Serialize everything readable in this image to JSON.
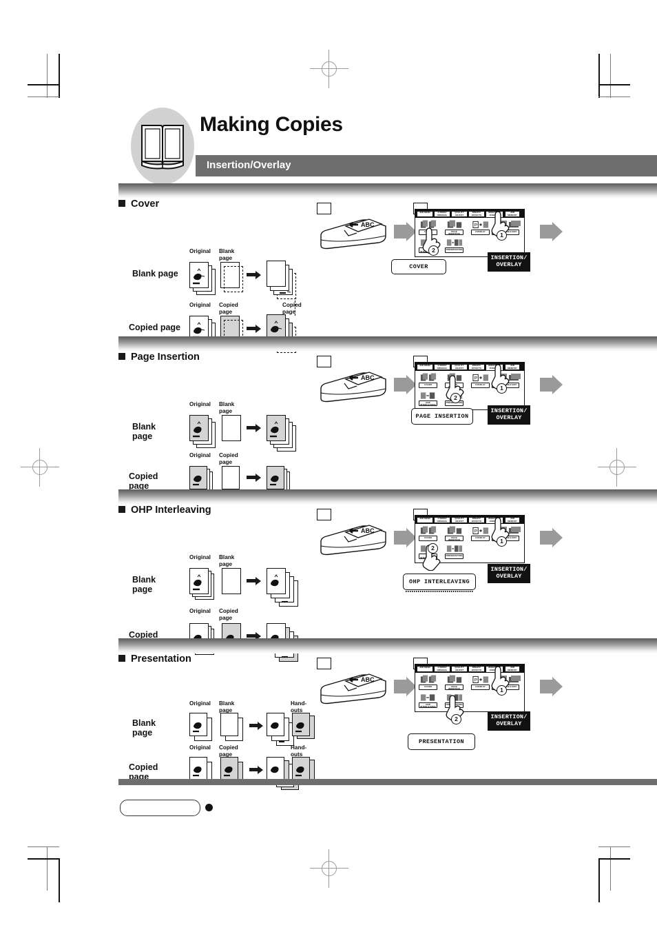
{
  "header": {
    "title": "Making Copies",
    "subtitle": "Insertion/Overlay",
    "icon": "open-book-icon"
  },
  "sections": [
    {
      "id": "cover",
      "title": "Cover",
      "rows": [
        {
          "label": "Blank page",
          "columns": [
            "Original",
            "Blank page",
            "",
            ""
          ]
        },
        {
          "label": "Copied page",
          "columns": [
            "Original",
            "Copied page",
            "Copied page",
            ""
          ]
        }
      ],
      "step1": {
        "number": "1",
        "target_label": "INSERTION/ OVERLAY"
      },
      "step2": {
        "number": "2",
        "callout": "COVER"
      }
    },
    {
      "id": "page-insertion",
      "title": "Page Insertion",
      "rows": [
        {
          "label": "Blank page",
          "columns": [
            "Original",
            "Blank page",
            "",
            ""
          ]
        },
        {
          "label": "Copied page",
          "columns": [
            "Original",
            "Copied page",
            "",
            ""
          ]
        }
      ],
      "step1": {
        "number": "1",
        "target_label": "INSERTION/ OVERLAY"
      },
      "step2": {
        "number": "2",
        "callout": "PAGE INSERTION"
      }
    },
    {
      "id": "ohp-interleaving",
      "title": "OHP Interleaving",
      "rows": [
        {
          "label": "Blank page",
          "columns": [
            "Original",
            "Blank page",
            "",
            ""
          ]
        },
        {
          "label": "Copied page",
          "columns": [
            "Original",
            "Copied page",
            "",
            ""
          ]
        }
      ],
      "step1": {
        "number": "1",
        "target_label": "INSERTION/ OVERLAY"
      },
      "step2": {
        "number": "2",
        "callout": "OHP INTERLEAVING"
      }
    },
    {
      "id": "presentation",
      "title": "Presentation",
      "rows": [
        {
          "label": "Blank page",
          "columns": [
            "Original",
            "Blank page",
            "",
            "Hand-outs"
          ]
        },
        {
          "label": "Copied page",
          "columns": [
            "Original",
            "Copied page",
            "",
            "Hand-outs"
          ]
        }
      ],
      "step1": {
        "number": "1",
        "target_label": "INSERTION/ OVERLAY"
      },
      "step2": {
        "number": "2",
        "callout": "PRESENTATION"
      }
    }
  ],
  "panel": {
    "tabs": [
      {
        "id": "job-menu",
        "label": "JOB MENU"
      },
      {
        "id": "2-sided",
        "label": "2-SIDED/ ORIGINAL"
      },
      {
        "id": "quality",
        "label": "QUALITY ADJUST"
      },
      {
        "id": "binary",
        "label": "BINARY/ EFFECTS"
      },
      {
        "id": "insertion",
        "label": "INSERTION/ OVERLAY"
      },
      {
        "id": "job-memory",
        "label": "JOB MEMORY"
      }
    ],
    "selected_tab": "insertion",
    "buttons": [
      {
        "id": "cover",
        "label": "COVER",
        "icon": "cover-pages-icon"
      },
      {
        "id": "page-insertion",
        "label": "PAGE INSERTION",
        "icon": "page-insertion-icon"
      },
      {
        "id": "overlay",
        "label": "OVERLAY",
        "icon": "overlay-icon"
      },
      {
        "id": "image-repeat",
        "label": "IMAGE",
        "icon": "image-repeat-icon"
      },
      {
        "id": "file-edit",
        "label": "FILE EDIT",
        "icon": "file-edit-icon"
      },
      {
        "id": "ohp-interleaving",
        "label": "OHP INTERLEAVING",
        "icon": "ohp-interleaving-icon"
      },
      {
        "id": "presentation",
        "label": "PRESENTATION",
        "icon": "presentation-icon"
      }
    ]
  },
  "machine": {
    "document_text": "ABC",
    "icon": "copier-adf-icon"
  },
  "footer": {
    "page_number": "",
    "dot": "page-marker-dot"
  },
  "colors": {
    "header_bar": "#6e6e6e",
    "section_bar_dark": "#5d5d5d",
    "icon_bg": "#d2d2d2",
    "sheet_gray": "#d4d4d4",
    "ink": "#111111",
    "arrow_gray": "#9a9a9a"
  }
}
